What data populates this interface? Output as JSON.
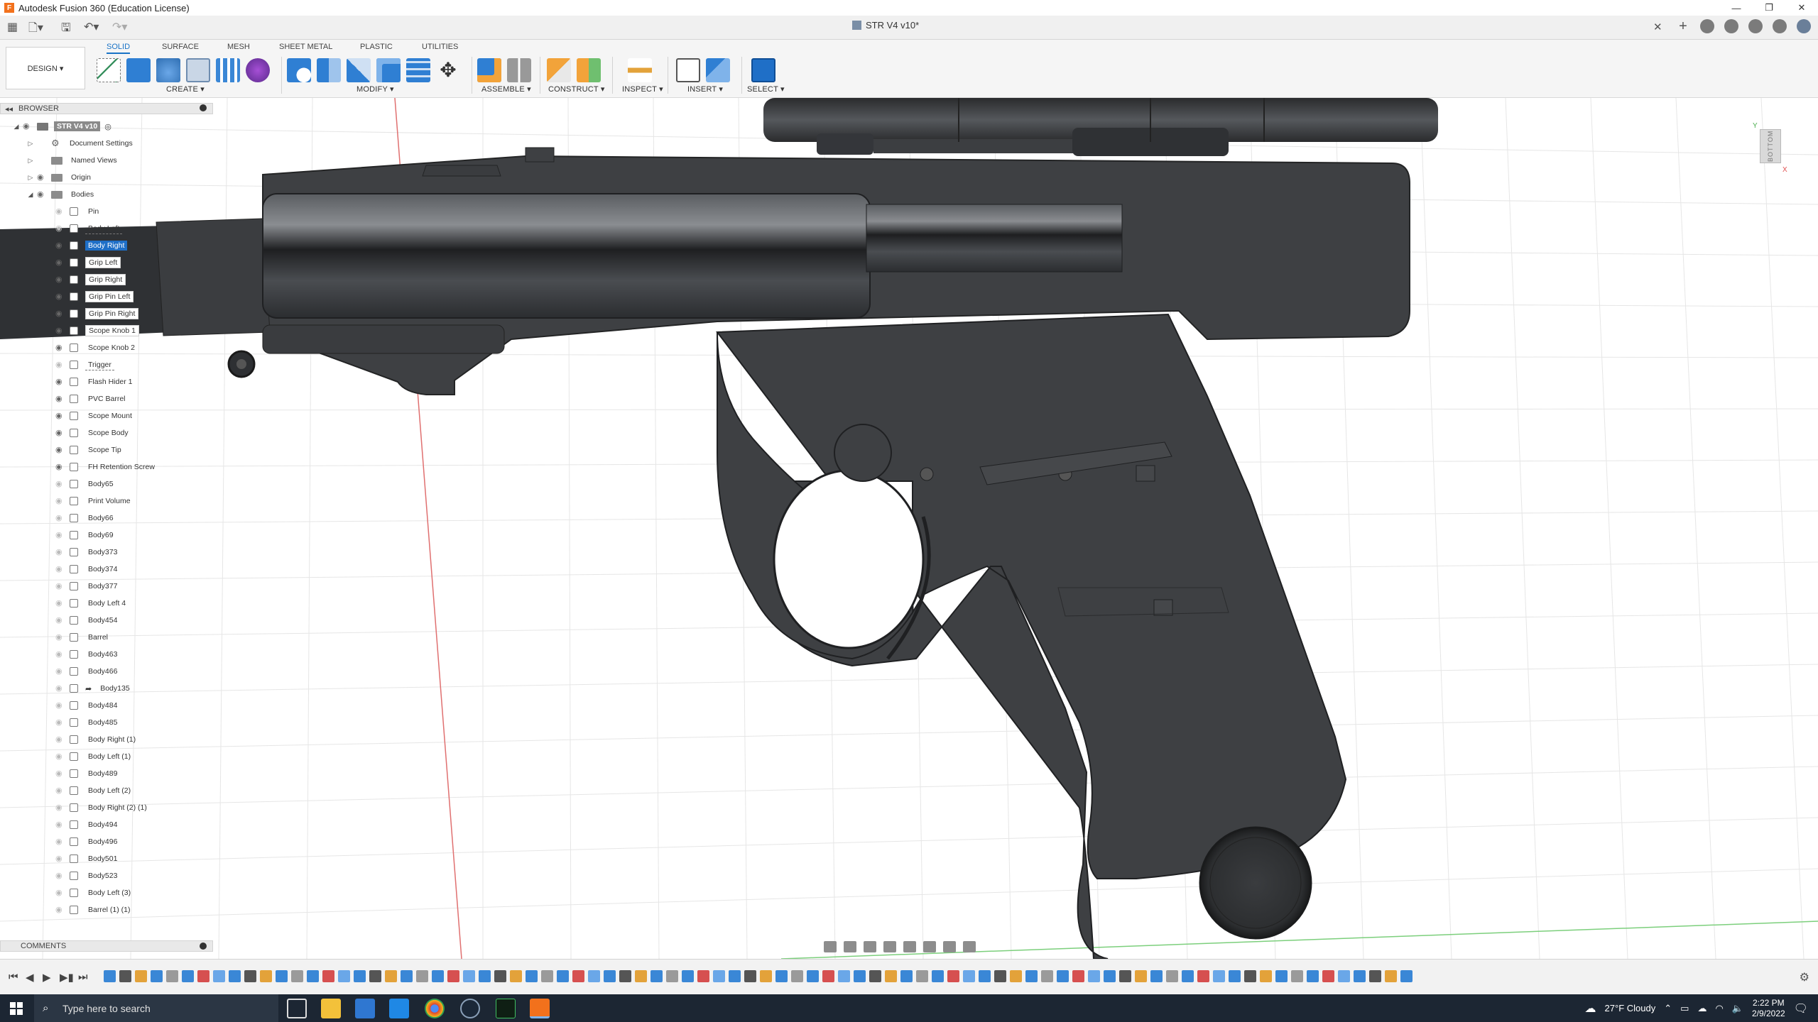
{
  "window": {
    "title": "Autodesk Fusion 360 (Education License)",
    "controls": [
      "—",
      "❐",
      "✕"
    ]
  },
  "document": {
    "tab_title": "STR V4 v10*",
    "tab_close": "✕"
  },
  "toolbar": {
    "workspace_button": "DESIGN ▾",
    "tabs": [
      {
        "label": "SOLID",
        "active": true
      },
      {
        "label": "SURFACE",
        "active": false
      },
      {
        "label": "MESH",
        "active": false
      },
      {
        "label": "SHEET METAL",
        "active": false
      },
      {
        "label": "PLASTIC",
        "active": false
      },
      {
        "label": "UTILITIES",
        "active": false
      }
    ],
    "groups": [
      "CREATE ▾",
      "MODIFY ▾",
      "ASSEMBLE ▾",
      "CONSTRUCT ▾",
      "INSPECT ▾",
      "INSERT ▾",
      "SELECT ▾"
    ]
  },
  "browser": {
    "title": "BROWSER",
    "root": "STR V4 v10",
    "folders": [
      {
        "label": "Document Settings",
        "icon": "gear-icon"
      },
      {
        "label": "Named Views",
        "icon": "folder-icon"
      },
      {
        "label": "Origin",
        "icon": "folder-icon"
      },
      {
        "label": "Bodies",
        "icon": "folder-icon"
      }
    ],
    "bodies": [
      {
        "label": "Pin",
        "visible": false,
        "style": "plain"
      },
      {
        "label": "Body Left",
        "visible": false,
        "style": "dash"
      },
      {
        "label": "Body Right",
        "visible": true,
        "style": "sel"
      },
      {
        "label": "Grip Left",
        "visible": true,
        "style": "outlined"
      },
      {
        "label": "Grip Right",
        "visible": true,
        "style": "outlined"
      },
      {
        "label": "Grip Pin Left",
        "visible": true,
        "style": "outlined"
      },
      {
        "label": "Grip Pin Right",
        "visible": true,
        "style": "outlined"
      },
      {
        "label": "Scope Knob 1",
        "visible": true,
        "style": "outlined"
      },
      {
        "label": "Scope Knob 2",
        "visible": true,
        "style": "plain"
      },
      {
        "label": "Trigger",
        "visible": false,
        "style": "dash"
      },
      {
        "label": "Flash Hider 1",
        "visible": true,
        "style": "plain"
      },
      {
        "label": "PVC Barrel",
        "visible": true,
        "style": "plain"
      },
      {
        "label": "Scope Mount",
        "visible": true,
        "style": "plain"
      },
      {
        "label": "Scope Body",
        "visible": true,
        "style": "plain"
      },
      {
        "label": "Scope Tip",
        "visible": true,
        "style": "plain"
      },
      {
        "label": "FH Retention Screw",
        "visible": true,
        "style": "plain"
      },
      {
        "label": "Body65",
        "visible": false,
        "style": "plain"
      },
      {
        "label": "Print Volume",
        "visible": false,
        "style": "plain"
      },
      {
        "label": "Body66",
        "visible": false,
        "style": "plain"
      },
      {
        "label": "Body69",
        "visible": false,
        "style": "plain"
      },
      {
        "label": "Body373",
        "visible": false,
        "style": "plain"
      },
      {
        "label": "Body374",
        "visible": false,
        "style": "plain"
      },
      {
        "label": "Body377",
        "visible": false,
        "style": "plain"
      },
      {
        "label": "Body Left 4",
        "visible": false,
        "style": "plain"
      },
      {
        "label": "Body454",
        "visible": false,
        "style": "plain"
      },
      {
        "label": "Barrel",
        "visible": false,
        "style": "plain"
      },
      {
        "label": "Body463",
        "visible": false,
        "style": "plain"
      },
      {
        "label": "Body466",
        "visible": false,
        "style": "plain"
      },
      {
        "label": "Body135",
        "visible": false,
        "style": "linked"
      },
      {
        "label": "Body484",
        "visible": false,
        "style": "plain"
      },
      {
        "label": "Body485",
        "visible": false,
        "style": "plain"
      },
      {
        "label": "Body Right (1)",
        "visible": false,
        "style": "plain"
      },
      {
        "label": "Body Left (1)",
        "visible": false,
        "style": "plain"
      },
      {
        "label": "Body489",
        "visible": false,
        "style": "plain"
      },
      {
        "label": "Body Left (2)",
        "visible": false,
        "style": "plain"
      },
      {
        "label": "Body Right (2) (1)",
        "visible": false,
        "style": "plain"
      },
      {
        "label": "Body494",
        "visible": false,
        "style": "plain"
      },
      {
        "label": "Body496",
        "visible": false,
        "style": "plain"
      },
      {
        "label": "Body501",
        "visible": false,
        "style": "plain"
      },
      {
        "label": "Body523",
        "visible": false,
        "style": "plain"
      },
      {
        "label": "Body Left (3)",
        "visible": false,
        "style": "plain"
      },
      {
        "label": "Barrel (1) (1)",
        "visible": false,
        "style": "plain"
      }
    ]
  },
  "viewcube": {
    "face": "BOTTOM",
    "axis_y": "Y",
    "axis_x": "X"
  },
  "comments": {
    "title": "COMMENTS"
  },
  "taskbar": {
    "search_placeholder": "Type here to search",
    "weather": "27°F  Cloudy",
    "time": "2:22 PM",
    "date": "2/9/2022"
  },
  "colors": {
    "accent": "#1f6fc7",
    "model": "#3e4043",
    "taskbar": "#1c2633",
    "toolbar": "#f5f5f5",
    "grid": "#e4e4e4",
    "x_axis": "#e05050",
    "z_axis": "#4caf50"
  }
}
